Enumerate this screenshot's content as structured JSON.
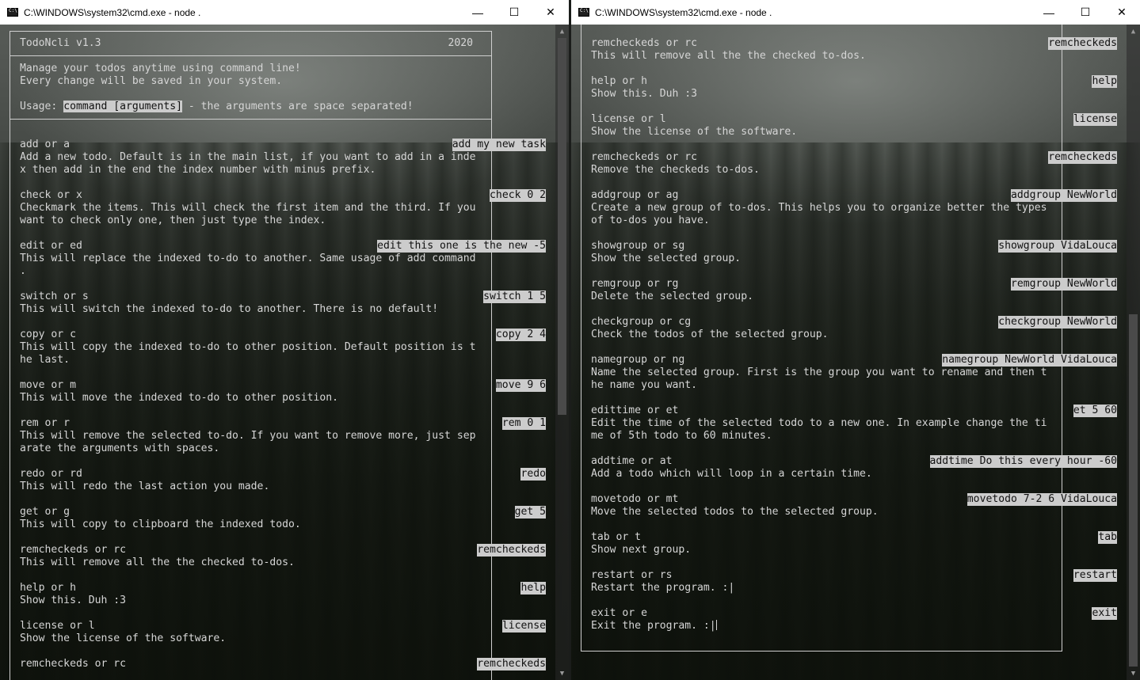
{
  "windows": [
    {
      "title": "C:\\WINDOWS\\system32\\cmd.exe - node .",
      "controls": {
        "minimize": "—",
        "maximize": "☐",
        "close": "✕"
      }
    },
    {
      "title": "C:\\WINDOWS\\system32\\cmd.exe - node .",
      "controls": {
        "minimize": "—",
        "maximize": "☐",
        "close": "✕"
      }
    }
  ],
  "header": {
    "app_name": "TodoNcli v1.3",
    "year": "2020",
    "line1": "Manage your todos anytime using command line!",
    "line2": "Every change will be saved in your system.",
    "usage_label": "Usage:",
    "usage_syntax": "command [arguments]",
    "usage_note": " - the arguments are space separated!"
  },
  "left_commands": [
    {
      "cmd": "add or a",
      "example": "add my new task",
      "desc": [
        "Add a new todo. Default is in the main list, if you want to add in a inde",
        "x then add in the end the index number with minus prefix."
      ]
    },
    {
      "cmd": "check or x",
      "example": "check 0 2",
      "desc": [
        "Checkmark the items. This will check the first item and the third. If you",
        "want to check only one, then just type the index."
      ]
    },
    {
      "cmd": "edit or ed",
      "example": "edit this one is the new -5",
      "desc": [
        "This will replace the indexed to-do to another. Same usage of add command",
        "."
      ]
    },
    {
      "cmd": "switch or s",
      "example": "switch 1 5",
      "desc": [
        "This will switch the indexed to-do to another. There is no default!"
      ]
    },
    {
      "cmd": "copy or c",
      "example": "copy 2 4",
      "desc": [
        "This will copy the indexed to-do to other position. Default position is t",
        "he last."
      ]
    },
    {
      "cmd": "move or m",
      "example": "move 9 6",
      "desc": [
        "This will move the indexed to-do to other position."
      ]
    },
    {
      "cmd": "rem or r",
      "example": "rem 0 1",
      "desc": [
        "This will remove the selected to-do. If you want to remove more, just sep",
        "arate the arguments with spaces."
      ]
    },
    {
      "cmd": "redo or rd",
      "example": "redo",
      "desc": [
        "This will redo the last action you made."
      ]
    },
    {
      "cmd": "get or g",
      "example": "get 5",
      "desc": [
        "This will copy to clipboard the indexed todo."
      ]
    },
    {
      "cmd": "remcheckeds or rc",
      "example": "remcheckeds",
      "desc": [
        "This will remove all the the checked to-dos."
      ]
    },
    {
      "cmd": "help or h",
      "example": "help",
      "desc": [
        "Show this. Duh :3"
      ]
    },
    {
      "cmd": "license or l",
      "example": "license",
      "desc": [
        "Show the license of the software."
      ]
    },
    {
      "cmd": "remcheckeds or rc",
      "example": "remcheckeds",
      "desc": []
    }
  ],
  "right_commands": [
    {
      "cmd": "remcheckeds or rc",
      "example": "remcheckeds",
      "desc": [
        "This will remove all the the checked to-dos."
      ]
    },
    {
      "cmd": "help or h",
      "example": "help",
      "desc": [
        "Show this. Duh :3"
      ]
    },
    {
      "cmd": "license or l",
      "example": "license",
      "desc": [
        "Show the license of the software."
      ]
    },
    {
      "cmd": "remcheckeds or rc",
      "example": "remcheckeds",
      "desc": [
        "Remove the checkeds to-dos."
      ]
    },
    {
      "cmd": "addgroup or ag",
      "example": "addgroup NewWorld",
      "desc": [
        "Create a new group of to-dos. This helps you to organize better the types",
        "of to-dos you have."
      ]
    },
    {
      "cmd": "showgroup or sg",
      "example": "showgroup VidaLouca",
      "desc": [
        "Show the selected group."
      ]
    },
    {
      "cmd": "remgroup or rg",
      "example": "remgroup NewWorld",
      "desc": [
        "Delete the selected group."
      ]
    },
    {
      "cmd": "checkgroup or cg",
      "example": "checkgroup NewWorld",
      "desc": [
        "Check the todos of the selected group."
      ]
    },
    {
      "cmd": "namegroup or ng",
      "example": "namegroup NewWorld VidaLouca",
      "desc": [
        "Name the selected group. First is the group you want to rename and then t",
        "he name you want."
      ]
    },
    {
      "cmd": "edittime or et",
      "example": "et 5 60",
      "desc": [
        "Edit the time of the selected todo to a new one. In example change the ti",
        "me of 5th todo to 60 minutes."
      ]
    },
    {
      "cmd": "addtime or at",
      "example": "addtime Do this every hour -60",
      "desc": [
        "Add a todo which will loop in a certain time."
      ]
    },
    {
      "cmd": "movetodo or mt",
      "example": "movetodo 7-2 6 VidaLouca",
      "desc": [
        "Move the selected todos to the selected group."
      ]
    },
    {
      "cmd": "tab or t",
      "example": "tab",
      "desc": [
        "Show next group."
      ]
    },
    {
      "cmd": "restart or rs",
      "example": "restart",
      "desc": [
        "Restart the program. :|"
      ]
    },
    {
      "cmd": "exit or e",
      "example": "exit",
      "desc": [
        "Exit the program. :|"
      ]
    }
  ]
}
